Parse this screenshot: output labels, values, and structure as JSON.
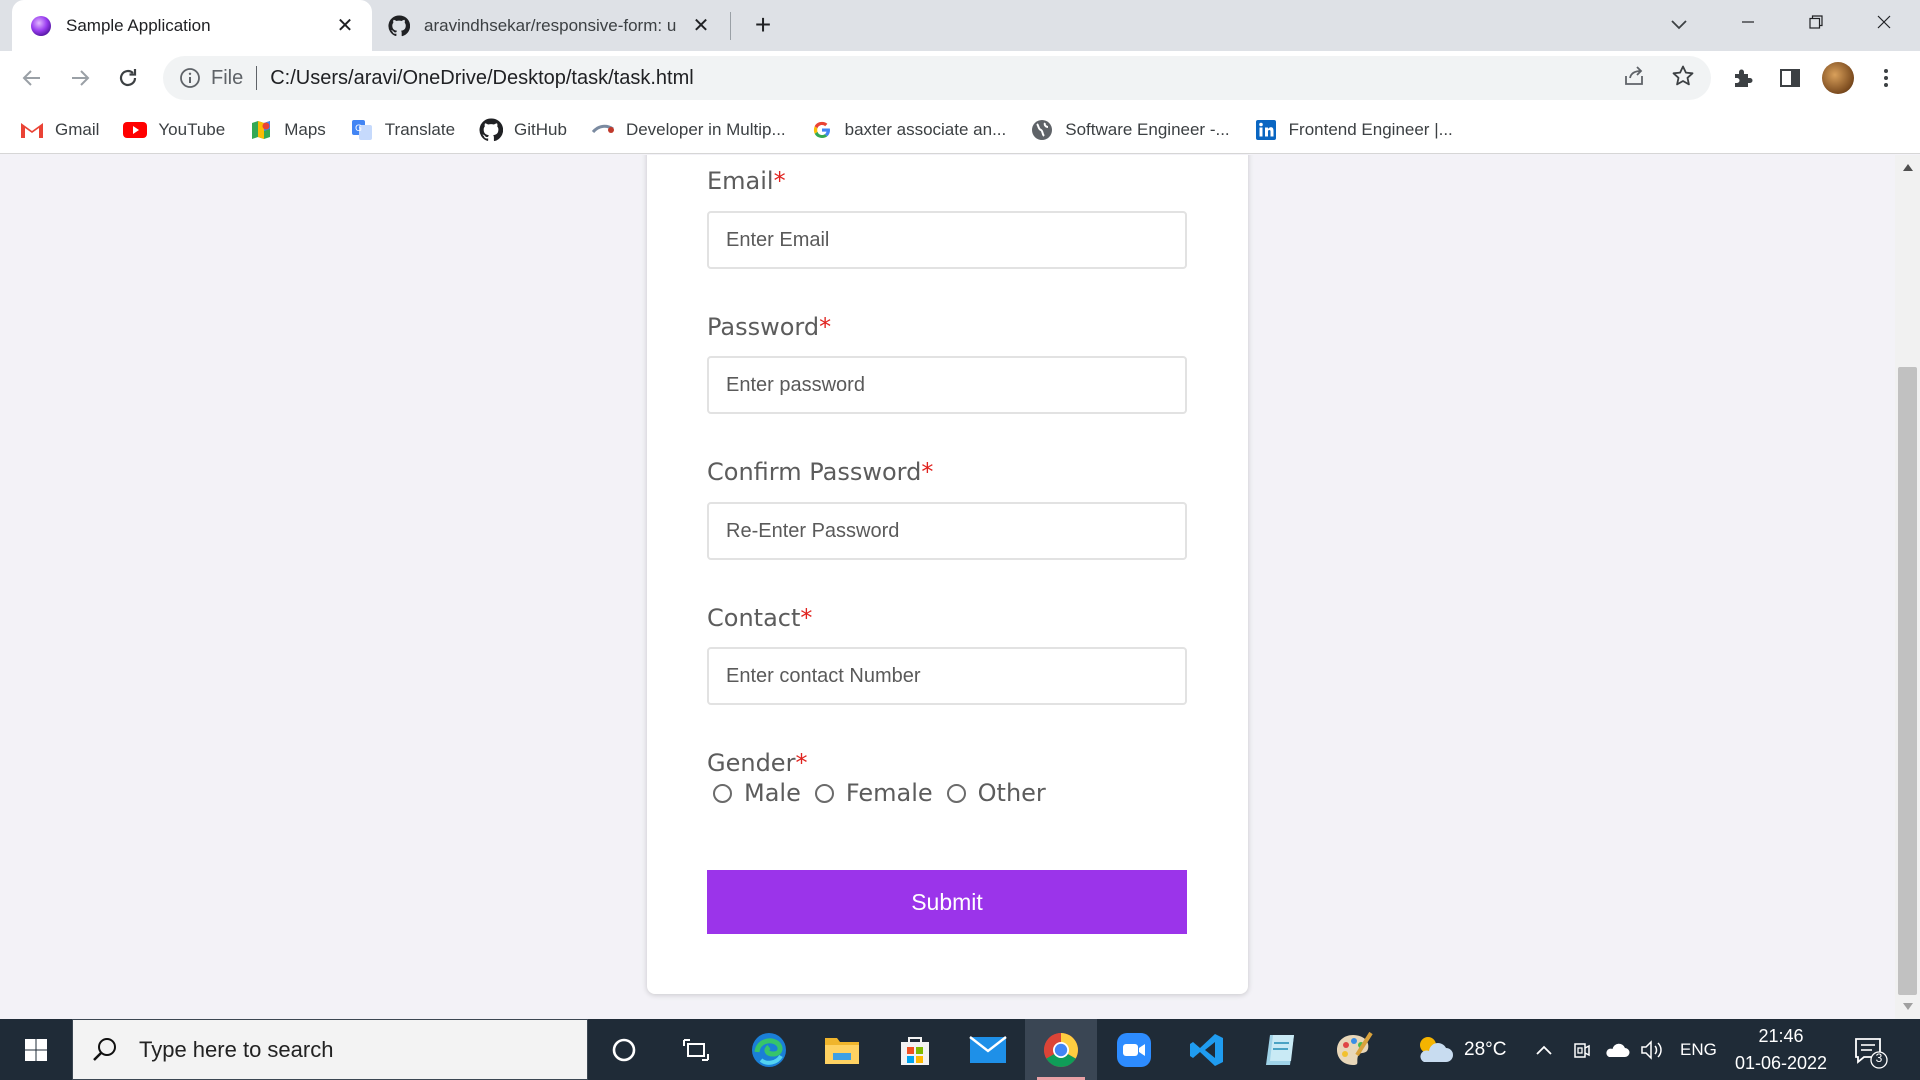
{
  "browser": {
    "tabs": [
      {
        "title": "Sample Application",
        "active": true,
        "favicon": "purple-orb-icon"
      },
      {
        "title": "aravindhsekar/responsive-form: u",
        "active": false,
        "favicon": "github-icon"
      }
    ],
    "url_scheme": "File",
    "url": "C:/Users/aravi/OneDrive/Desktop/task/task.html",
    "bookmarks": [
      {
        "label": "Gmail",
        "icon": "gmail-icon"
      },
      {
        "label": "YouTube",
        "icon": "youtube-icon"
      },
      {
        "label": "Maps",
        "icon": "maps-icon"
      },
      {
        "label": "Translate",
        "icon": "translate-icon"
      },
      {
        "label": "GitHub",
        "icon": "github-icon"
      },
      {
        "label": "Developer in Multip...",
        "icon": "developer-site-icon"
      },
      {
        "label": "baxter associate an...",
        "icon": "google-icon"
      },
      {
        "label": "Software Engineer -...",
        "icon": "globe-icon"
      },
      {
        "label": "Frontend Engineer |...",
        "icon": "linkedin-icon"
      }
    ]
  },
  "form": {
    "email": {
      "label": "Email",
      "required_mark": "*",
      "placeholder": "Enter Email"
    },
    "password": {
      "label": "Password",
      "required_mark": "*",
      "placeholder": "Enter password"
    },
    "confirm_password": {
      "label": "Confirm Password",
      "required_mark": "*",
      "placeholder": "Re-Enter Password"
    },
    "contact": {
      "label": "Contact",
      "required_mark": "*",
      "placeholder": "Enter contact Number"
    },
    "gender": {
      "label": "Gender",
      "required_mark": "*",
      "options": [
        "Male",
        "Female",
        "Other"
      ]
    },
    "submit_label": "Submit"
  },
  "colors": {
    "accent": "#9b34ea",
    "required": "#e0231f",
    "page_bg": "#f3f2f7"
  },
  "taskbar": {
    "search_placeholder": "Type here to search",
    "weather": "28°C",
    "language": "ENG",
    "time": "21:46",
    "date": "01-06-2022",
    "notification_count": "3"
  }
}
